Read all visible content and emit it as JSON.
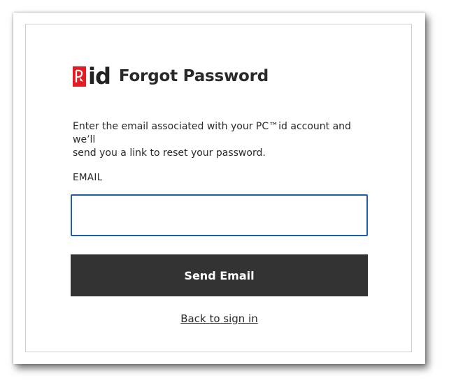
{
  "brand": {
    "logo_text": "id",
    "logo_color": "#e41b23"
  },
  "page": {
    "title": "Forgot Password",
    "intro_line1": "Enter the email associated with your PC™id account and we’ll",
    "intro_line2": "send you a link to reset your password."
  },
  "form": {
    "email_label": "EMAIL",
    "email_value": "",
    "email_placeholder": "",
    "submit_label": "Send Email",
    "back_link_label": "Back to sign in"
  },
  "colors": {
    "button_bg": "#333333",
    "input_border": "#1e5fa8"
  },
  "icons": {
    "logo": "pc-maple-leaf-logo-icon"
  }
}
